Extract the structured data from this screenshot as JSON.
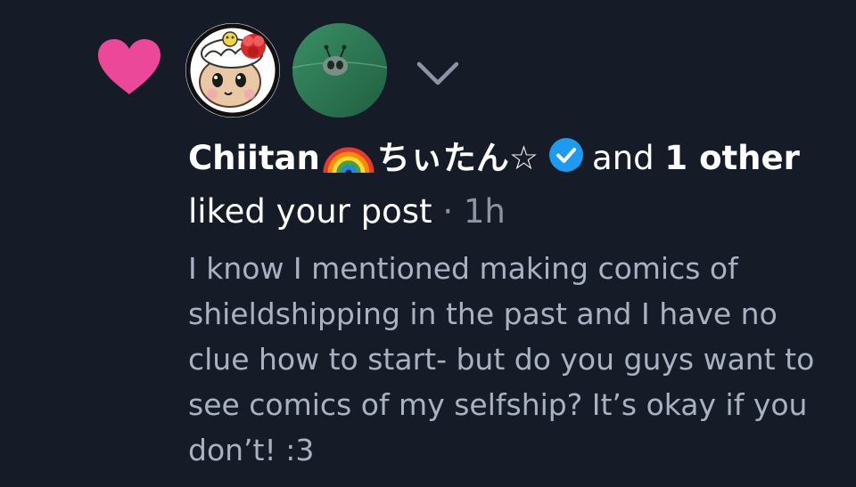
{
  "notification": {
    "type": "like",
    "icons": {
      "reaction": "heart-icon",
      "expand": "chevron-down-icon",
      "verified": "verified-badge-icon",
      "emoji": "rainbow-emoji"
    },
    "colors": {
      "background": "#151c28",
      "heart": "#ec4899",
      "verified": "#1d9bf0",
      "primary_text": "#ffffff",
      "secondary_text": "#a9b2c2"
    },
    "actor": {
      "name_prefix": "Chiitan",
      "name_suffix": "ちぃたん☆",
      "verified": true
    },
    "and_text": "and",
    "other_count": "1",
    "other_word": "other",
    "action_text": "liked your post",
    "separator": "·",
    "time": "1h",
    "post_text": "I know I mentioned making comics of shieldshipping in the past and I have no clue how to start- but do you guys want to see comics of my selfship? It’s okay if you don’t! :3"
  }
}
